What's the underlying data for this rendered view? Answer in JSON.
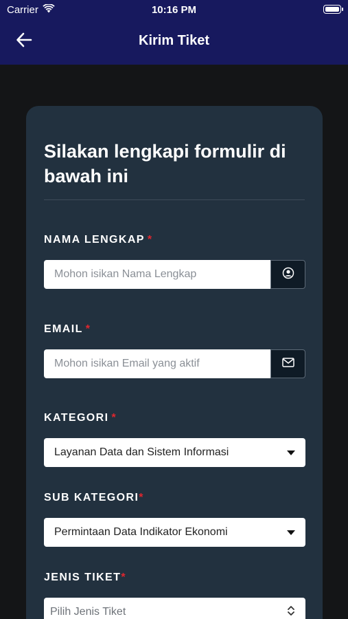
{
  "status_bar": {
    "carrier": "Carrier",
    "time": "10:16 PM"
  },
  "nav": {
    "title": "Kirim Tiket",
    "back_icon": "arrow-left-icon"
  },
  "form": {
    "heading": "Silakan lengkapi formulir di bawah ini",
    "required_mark": "*",
    "nama": {
      "label": "NAMA LENGKAP",
      "placeholder": "Mohon isikan Nama Lengkap",
      "value": "",
      "icon": "user-circle-icon"
    },
    "email": {
      "label": "EMAIL",
      "placeholder": "Mohon isikan Email yang aktif",
      "value": "",
      "icon": "envelope-icon"
    },
    "kategori": {
      "label": "KATEGORI",
      "value": "Layanan Data dan Sistem Informasi"
    },
    "sub_kategori": {
      "label": "SUB KATEGORI",
      "value": "Permintaan Data Indikator Ekonomi"
    },
    "jenis_tiket": {
      "label": "JENIS TIKET",
      "placeholder": "Pilih Jenis Tiket"
    }
  },
  "colors": {
    "nav_background": "#17195e",
    "page_background": "#141517",
    "card_background": "#22313f",
    "required_red": "#e0262e"
  }
}
